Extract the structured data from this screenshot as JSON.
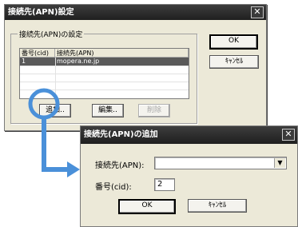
{
  "main_dialog": {
    "title": "接続先(APN)設定",
    "close_glyph": "✕",
    "group_title": "接続先(APN)の設定",
    "table": {
      "headers": [
        "番号(cid)",
        "接続先(APN)"
      ],
      "rows": [
        {
          "cid": "1",
          "apn": "mopera.ne.jp"
        }
      ]
    },
    "buttons": {
      "ok": "OK",
      "cancel": "ｷｬﾝｾﾙ",
      "add": "追加..",
      "edit": "編集..",
      "delete": "削除"
    }
  },
  "add_dialog": {
    "title": "接続先(APN)の追加",
    "close_glyph": "✕",
    "apn_label": "接続先(APN):",
    "apn_value": "",
    "cid_label": "番号(cid):",
    "cid_value": "2",
    "buttons": {
      "ok": "OK",
      "cancel": "ｷｬﾝｾﾙ"
    }
  },
  "colors": {
    "callout": "#4a90d9"
  }
}
